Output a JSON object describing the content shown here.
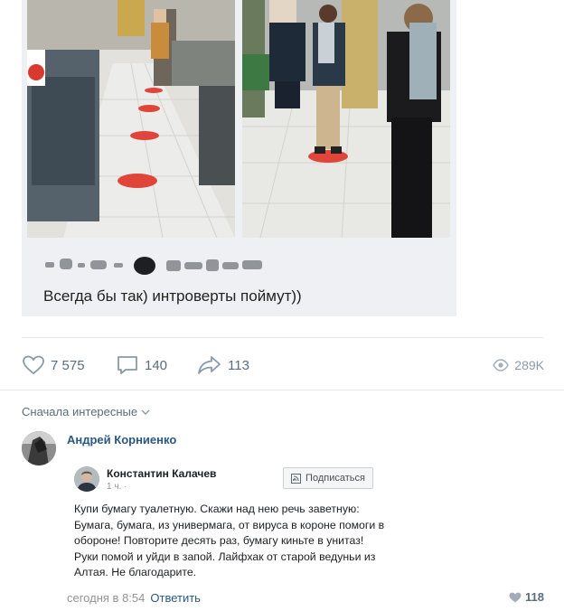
{
  "post": {
    "caption": "Всегда бы так) интроверты поймут))",
    "likes": "7 575",
    "comments": "140",
    "shares": "113",
    "views": "289K"
  },
  "comments_section": {
    "sort_label": "Сначала интересные"
  },
  "comment": {
    "author": "Андрей Корниенко",
    "time": "сегодня в 8:54",
    "reply_label": "Ответить",
    "likes": "118"
  },
  "embedded_post": {
    "author": "Константин Калачев",
    "time": "1 ч. ·",
    "subscribe_label": "Подписаться",
    "text": "Купи бумагу туалетную. Скажи над нею речь заветную: Бумага, бумага, из универмага, от вируса в короне помоги в обороне! Повторите десять раз, бумагу киньте в унитаз! Руки помой и уйди в запой. Лайфхак от старой ведуньи из Алтая. Не благодарите."
  },
  "icons": {
    "like": "heart-icon",
    "comment": "comment-icon",
    "share": "share-icon",
    "views": "eye-icon",
    "sort": "chevron-down-icon"
  },
  "colors": {
    "link": "#2a5885",
    "action_text": "#5c6c7d",
    "floor_sticker": "#e0453a"
  }
}
